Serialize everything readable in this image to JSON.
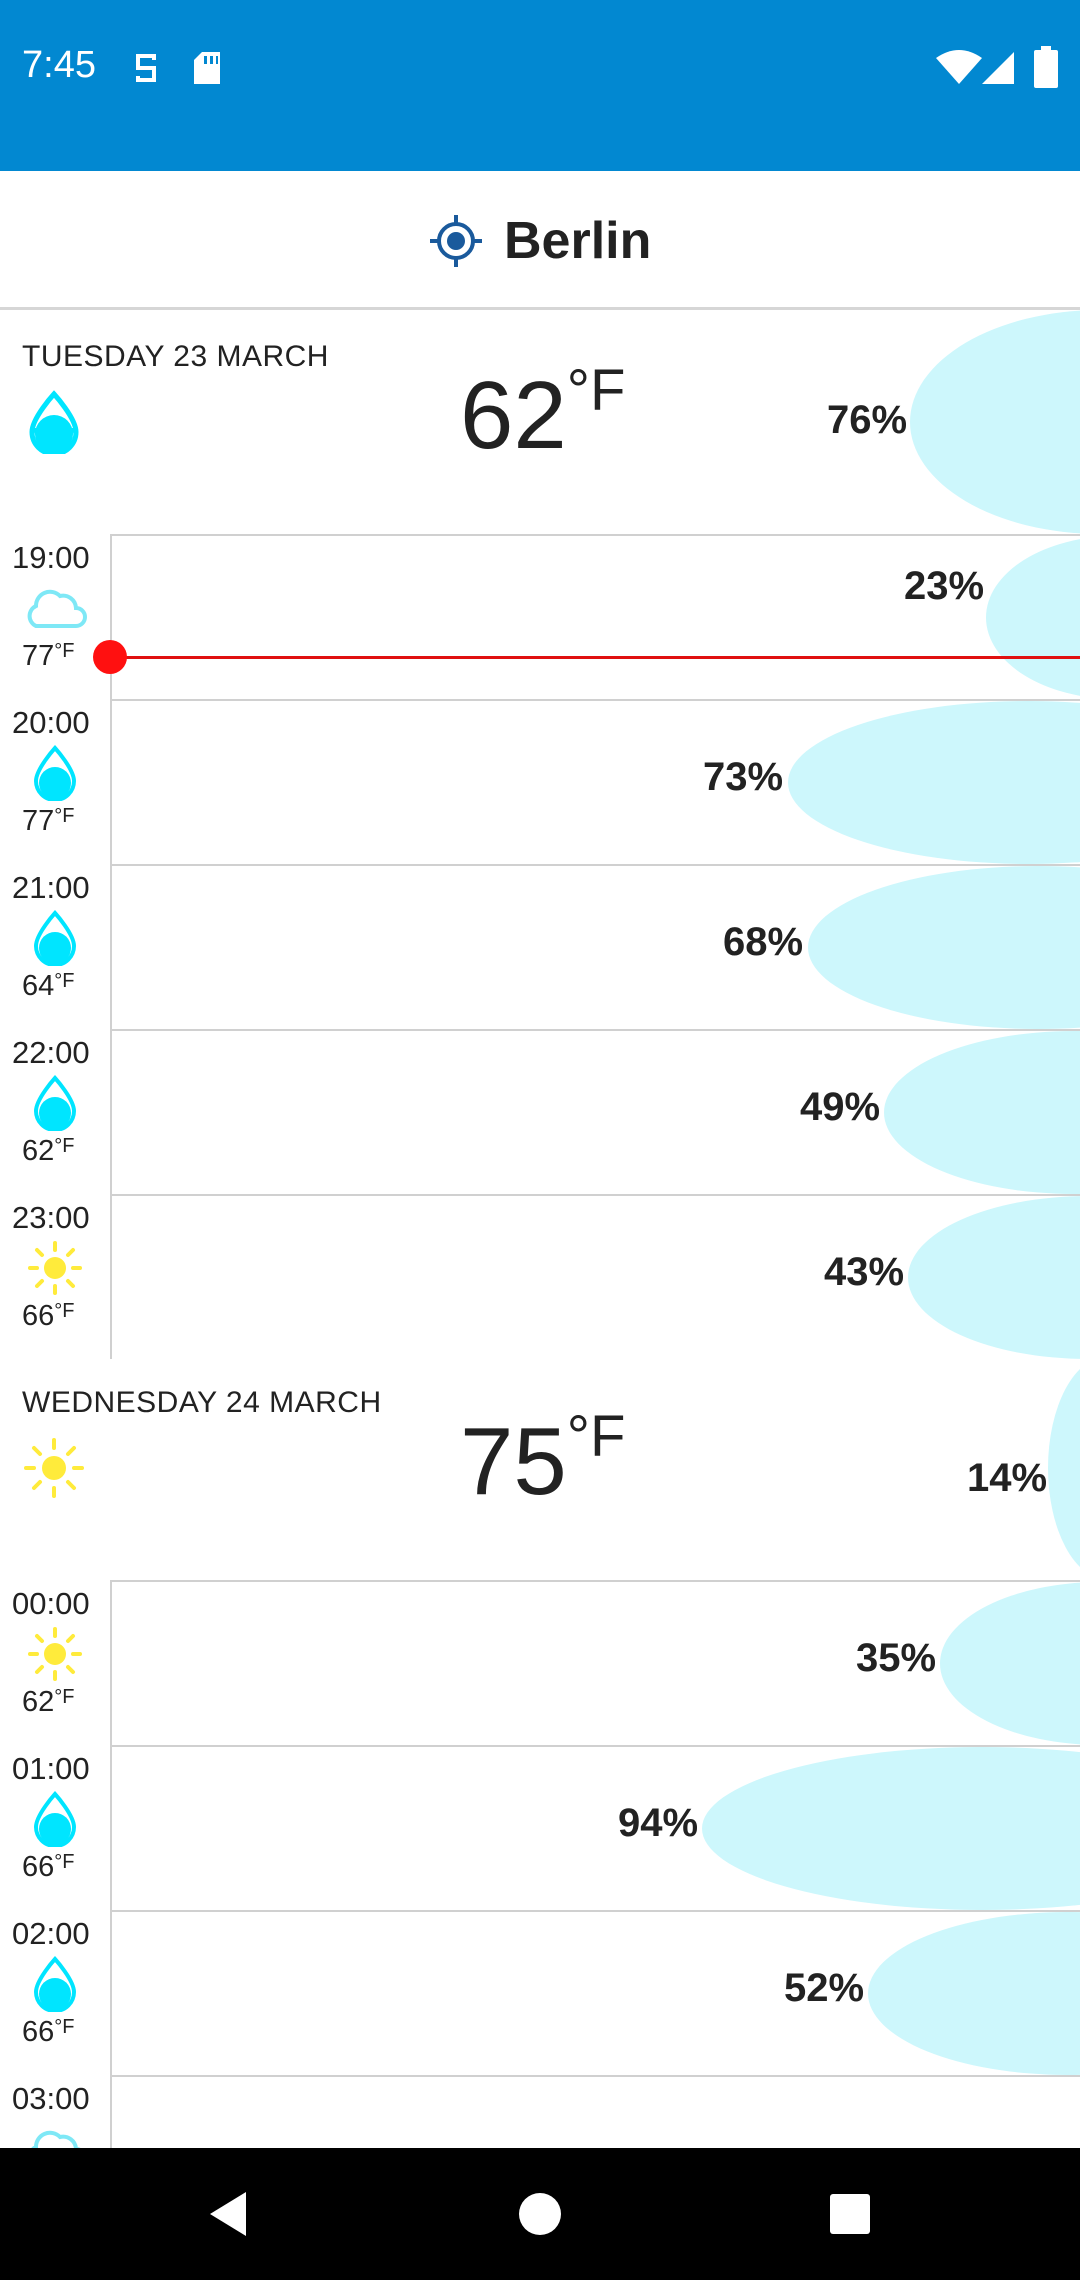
{
  "status_bar": {
    "time": "7:45",
    "icons": [
      "sim-toolkit-icon",
      "sd-card-icon",
      "wifi-icon",
      "cell-signal-icon",
      "battery-icon"
    ],
    "color": "#0288d1"
  },
  "location": {
    "icon": "location-target-icon",
    "city": "Berlin"
  },
  "colors": {
    "rain_blob": "#cdf7fc",
    "now_line": "#e01010",
    "rain_icon": "#00e5ff",
    "sun_icon": "#ffeb3b"
  },
  "days": [
    {
      "label": "TUESDAY 23 MARCH",
      "icon": "rain-drop-icon",
      "temp": "62",
      "temp_unit": "°F",
      "rain": "76%",
      "hours": [
        {
          "time": "19:00",
          "icon": "cloud-icon",
          "temp": "77",
          "unit": "°F",
          "rain": "23%",
          "now": true
        },
        {
          "time": "20:00",
          "icon": "rain-drop-icon",
          "temp": "77",
          "unit": "°F",
          "rain": "73%"
        },
        {
          "time": "21:00",
          "icon": "rain-drop-icon",
          "temp": "64",
          "unit": "°F",
          "rain": "68%"
        },
        {
          "time": "22:00",
          "icon": "rain-drop-icon",
          "temp": "62",
          "unit": "°F",
          "rain": "49%"
        },
        {
          "time": "23:00",
          "icon": "sun-icon",
          "temp": "66",
          "unit": "°F",
          "rain": "43%"
        }
      ]
    },
    {
      "label": "WEDNESDAY 24 MARCH",
      "icon": "sun-icon",
      "temp": "75",
      "temp_unit": "°F",
      "rain": "14%",
      "hours": [
        {
          "time": "00:00",
          "icon": "sun-icon",
          "temp": "62",
          "unit": "°F",
          "rain": "35%"
        },
        {
          "time": "01:00",
          "icon": "rain-drop-icon",
          "temp": "66",
          "unit": "°F",
          "rain": "94%"
        },
        {
          "time": "02:00",
          "icon": "rain-drop-icon",
          "temp": "66",
          "unit": "°F",
          "rain": "52%"
        },
        {
          "time": "03:00",
          "icon": "cloud-icon",
          "temp": "",
          "unit": "",
          "rain": ""
        }
      ]
    }
  ],
  "nav_bar": {
    "buttons": [
      "back-icon",
      "home-icon",
      "recents-icon"
    ]
  }
}
